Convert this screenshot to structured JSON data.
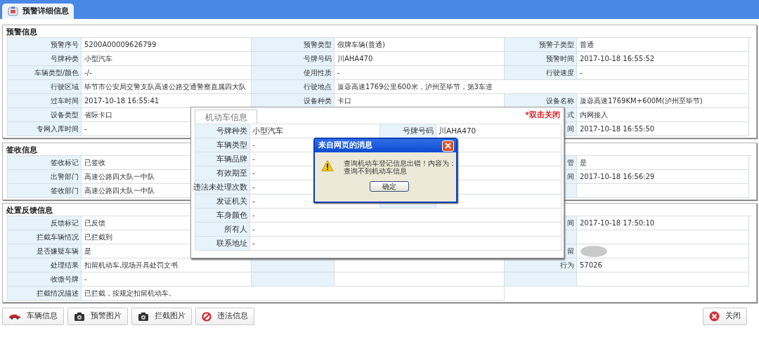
{
  "tab": {
    "label": "预警详细信息",
    "selected": true
  },
  "sections": [
    {
      "title": "预警信息",
      "rows": [
        [
          {
            "label": "预警序号",
            "value": "5200A00009626799"
          },
          {
            "label": "预警类型",
            "value": "假牌车辆(普通)"
          },
          {
            "label": "预警子类型",
            "value": "普通"
          }
        ],
        [
          {
            "label": "号牌种类",
            "value": "小型汽车"
          },
          {
            "label": "号牌号码",
            "value": "川AHA470"
          },
          {
            "label": "预警时间",
            "value": "2017-10-18 16:55:52"
          }
        ],
        [
          {
            "label": "车辆类型/颜色",
            "value": "-/-"
          },
          {
            "label": "使用性质",
            "value": "-"
          },
          {
            "label": "行驶速度",
            "value": "-"
          }
        ],
        [
          {
            "label": "行驶区域",
            "value": "毕节市公安局交警支队高速公路交通警察直属四大队"
          },
          {
            "label": "行驶地点",
            "value": "厦蓉高速1769公里600米，泸州至毕节，第3车道",
            "wide": true
          }
        ],
        [
          {
            "label": "过车时间",
            "value": "2017-10-18 16:55:41"
          },
          {
            "label": "设备种类",
            "value": "卡口"
          },
          {
            "label": "设备名称",
            "value": "厦蓉高速1769KM+600M(泸州至毕节)"
          }
        ],
        [
          {
            "label": "设备类型",
            "value": "省际卡口"
          },
          {},
          {
            "label": "式",
            "value": "内网接入"
          }
        ],
        [
          {
            "label": "专网入库时间",
            "value": "-"
          },
          {},
          {
            "label": "间",
            "value": "2017-10-18 16:55:50"
          }
        ]
      ]
    },
    {
      "title": "签收信息",
      "rows": [
        [
          {
            "label": "签收标记",
            "value": "已签收"
          },
          {},
          {
            "label": "管",
            "value": "是"
          }
        ],
        [
          {
            "label": "出警部门",
            "value": "高速公路四大队一中队"
          },
          {},
          {
            "label": "间",
            "value": "2017-10-18 16:56:29"
          }
        ],
        [
          {
            "label": "签收部门",
            "value": "高速公路四大队一中队"
          },
          {},
          {}
        ]
      ]
    },
    {
      "title": "处置反馈信息",
      "rows": [
        [
          {
            "label": "反馈标记",
            "value": "已反馈"
          },
          {},
          {
            "label": "间",
            "value": "2017-10-18 17:50:10"
          }
        ],
        [
          {
            "label": "拦截车辆情况",
            "value": "已拦截到"
          },
          {},
          {}
        ],
        [
          {
            "label": "是否嫌疑车辆",
            "value": "是"
          },
          {},
          {
            "label": "留",
            "blurred": true
          }
        ],
        [
          {
            "label": "处理结果",
            "value": "扣留机动车,现场开具处罚文书"
          },
          {},
          {
            "label": "行为",
            "value": "57026"
          }
        ],
        [
          {
            "label": "收缴号牌",
            "value": "-"
          },
          {},
          {}
        ],
        [
          {
            "label": "拦截情况描述",
            "value": "已拦截，按规定扣留机动车。",
            "wide": true
          }
        ]
      ]
    }
  ],
  "buttons": [
    {
      "label": "车辆信息"
    },
    {
      "label": "预警图片"
    },
    {
      "label": "拦截图片"
    },
    {
      "label": "违法信息"
    }
  ],
  "close_button": {
    "label": "关闭"
  },
  "vehicle_panel": {
    "tab": "机动车信息",
    "close_hint": "*双击关闭",
    "rows": [
      [
        {
          "label": "号牌种类",
          "value": "小型汽车"
        },
        {
          "label": "号牌号码",
          "value": "川AHA470"
        }
      ],
      [
        {
          "label": "车辆类型",
          "value": "-"
        },
        {}
      ],
      [
        {
          "label": "车辆品牌",
          "value": "-"
        },
        {}
      ],
      [
        {
          "label": "有效期至",
          "value": "-"
        },
        {}
      ],
      [
        {
          "label": "违法未处理次数",
          "value": "-"
        },
        {}
      ],
      [
        {
          "label": "发证机关",
          "value": "-"
        },
        {}
      ],
      [
        {
          "label": "车身颜色",
          "value": "-",
          "wide": true
        }
      ],
      [
        {
          "label": "所有人",
          "value": "-",
          "wide": true
        }
      ],
      [
        {
          "label": "联系地址",
          "value": "-",
          "wide": true
        }
      ]
    ]
  },
  "message_box": {
    "title": "来自网页的消息",
    "lines": [
      "查询机动车登记信息出错！内容为：",
      "查询不到机动车信息"
    ],
    "button": "确定"
  }
}
